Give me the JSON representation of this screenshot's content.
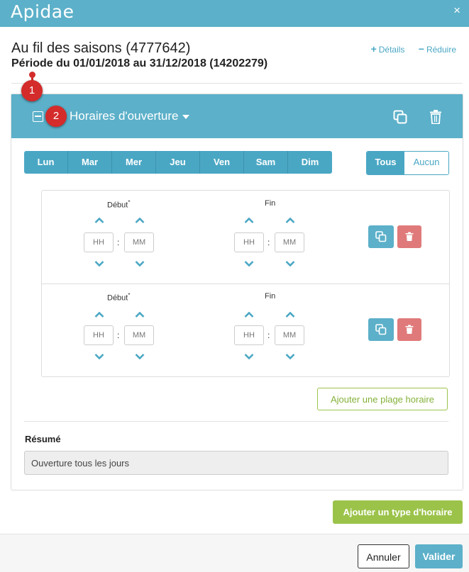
{
  "window": {
    "logo": "Apidae",
    "close_label": "×"
  },
  "header": {
    "title": "Au fil des saisons (4777642)",
    "period": "Période du 01/01/2018 au 31/12/2018 (14202279)",
    "details_label": "Détails",
    "reduce_label": "Réduire"
  },
  "markers": [
    "1",
    "2"
  ],
  "panel": {
    "title": "Horaires d'ouverture"
  },
  "days": [
    "Lun",
    "Mar",
    "Mer",
    "Jeu",
    "Ven",
    "Sam",
    "Dim"
  ],
  "toggle": {
    "all": "Tous",
    "none": "Aucun"
  },
  "slots": [
    {
      "start_label": "Début",
      "end_label": "Fin",
      "required_mark": "*",
      "hh": "HH",
      "mm": "MM",
      "sep": ":"
    },
    {
      "start_label": "Début",
      "end_label": "Fin",
      "required_mark": "*",
      "hh": "HH",
      "mm": "MM",
      "sep": ":"
    }
  ],
  "add_slot_label": "Ajouter une plage horaire",
  "resume": {
    "label": "Résumé",
    "value": "Ouverture tous les jours"
  },
  "add_type_label": "Ajouter un type d'horaire",
  "footer": {
    "cancel": "Annuler",
    "validate": "Valider"
  },
  "colors": {
    "primary": "#5cb0c9",
    "success": "#9bc34a",
    "danger": "#e07a7a",
    "marker": "#d42b2b"
  }
}
